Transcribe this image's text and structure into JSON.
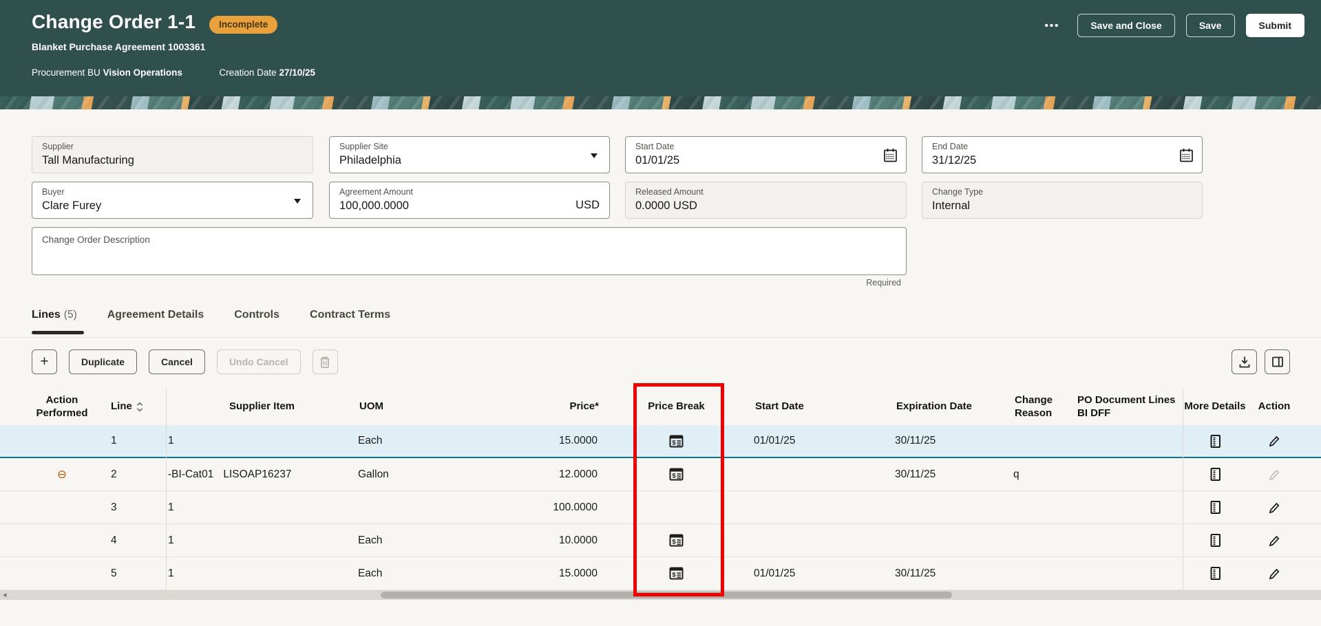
{
  "header": {
    "title": "Change Order 1-1",
    "status": "Incomplete",
    "subtitle": "Blanket Purchase Agreement 1003361",
    "procurement_bu_label": "Procurement BU",
    "procurement_bu_value": "Vision Operations",
    "creation_date_label": "Creation Date",
    "creation_date_value": "27/10/25",
    "more_actions": "•••",
    "buttons": {
      "save_and_close": "Save and Close",
      "save": "Save",
      "submit": "Submit"
    }
  },
  "form": {
    "supplier": {
      "label": "Supplier",
      "value": "Tall Manufacturing"
    },
    "supplier_site": {
      "label": "Supplier Site",
      "value": "Philadelphia"
    },
    "start_date": {
      "label": "Start Date",
      "value": "01/01/25"
    },
    "end_date": {
      "label": "End Date",
      "value": "31/12/25"
    },
    "buyer": {
      "label": "Buyer",
      "value": "Clare Furey"
    },
    "agreement_amount": {
      "label": "Agreement Amount",
      "value": "100,000.0000",
      "currency": "USD"
    },
    "released_amount": {
      "label": "Released Amount",
      "value": "0.0000 USD"
    },
    "change_type": {
      "label": "Change Type",
      "value": "Internal"
    },
    "description": {
      "label": "Change Order Description",
      "value": "",
      "required_hint": "Required"
    }
  },
  "tabs": {
    "lines_label": "Lines",
    "lines_count": "(5)",
    "agreement_details": "Agreement Details",
    "controls": "Controls",
    "contract_terms": "Contract Terms"
  },
  "toolbar": {
    "add": "+",
    "duplicate": "Duplicate",
    "cancel": "Cancel",
    "undo_cancel": "Undo Cancel"
  },
  "table": {
    "columns": {
      "action_performed": "Action Performed",
      "line": "Line",
      "supplier_item": "Supplier Item",
      "uom": "UOM",
      "price": "Price*",
      "price_break": "Price Break",
      "start_date": "Start Date",
      "expiration_date": "Expiration Date",
      "change_reason": "Change Reason",
      "po_dff": "PO Document Lines BI DFF",
      "more_details": "More Details",
      "action": "Action"
    },
    "rows": [
      {
        "line": "1",
        "item_a": "1",
        "item_b": "",
        "uom": "Each",
        "price": "15.0000",
        "has_price_break": true,
        "start_date": "01/01/25",
        "expiration_date": "30/11/25",
        "change_reason": "",
        "selected": true,
        "canceled": false,
        "action_enabled": true
      },
      {
        "line": "2",
        "item_a": "-BI-Cat01",
        "item_b": "LISOAP16237",
        "uom": "Gallon",
        "price": "12.0000",
        "has_price_break": true,
        "start_date": "",
        "expiration_date": "30/11/25",
        "change_reason": "q",
        "selected": false,
        "canceled": true,
        "action_enabled": false
      },
      {
        "line": "3",
        "item_a": "1",
        "item_b": "",
        "uom": "",
        "price": "100.0000",
        "has_price_break": false,
        "start_date": "",
        "expiration_date": "",
        "change_reason": "",
        "selected": false,
        "canceled": false,
        "action_enabled": true
      },
      {
        "line": "4",
        "item_a": "1",
        "item_b": "",
        "uom": "Each",
        "price": "10.0000",
        "has_price_break": true,
        "start_date": "",
        "expiration_date": "",
        "change_reason": "",
        "selected": false,
        "canceled": false,
        "action_enabled": true
      },
      {
        "line": "5",
        "item_a": "1",
        "item_b": "",
        "uom": "Each",
        "price": "15.0000",
        "has_price_break": true,
        "start_date": "01/01/25",
        "expiration_date": "30/11/25",
        "change_reason": "",
        "selected": false,
        "canceled": false,
        "action_enabled": true
      }
    ]
  },
  "icons": {
    "canceled_line": "⊖",
    "scroll_left": "◂"
  },
  "colors": {
    "header_teal": "#30504e",
    "badge_orange": "#e9a13b",
    "highlight_red": "#ec0000",
    "selected_row": "#e0eff6",
    "selected_row_border": "#0d7285"
  }
}
